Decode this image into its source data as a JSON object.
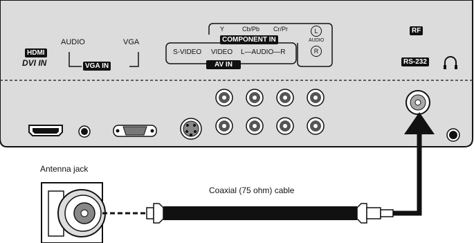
{
  "panel": {
    "hdmi": "HDMI",
    "dvi_in": "DVI IN",
    "audio": "AUDIO",
    "vga": "VGA",
    "vga_in": "VGA IN",
    "y": "Y",
    "cb_pb": "Cb/Pb",
    "cr_pr": "Cr/Pr",
    "component_in": "COMPONENT IN",
    "audio_small": "AUDIO",
    "left_mark": "L",
    "right_mark": "R",
    "s_video": "S-VIDEO",
    "video": "VIDEO",
    "l_audio_r": "L—AUDIO—R",
    "av_in": "AV IN",
    "rf": "RF",
    "rs232": "RS-232"
  },
  "diagram": {
    "antenna_jack": "Antenna jack",
    "cable_label": "Coaxial (75 ohm) cable"
  },
  "colors": {
    "panel_fill": "#dcdcdc",
    "line": "#111111",
    "background": "#ffffff"
  },
  "icons": [
    "headphone-icon",
    "hdmi-port-icon",
    "vga-port-icon",
    "svideo-port-icon",
    "rca-jack-icon",
    "rf-jack-icon",
    "arrow-icon"
  ]
}
